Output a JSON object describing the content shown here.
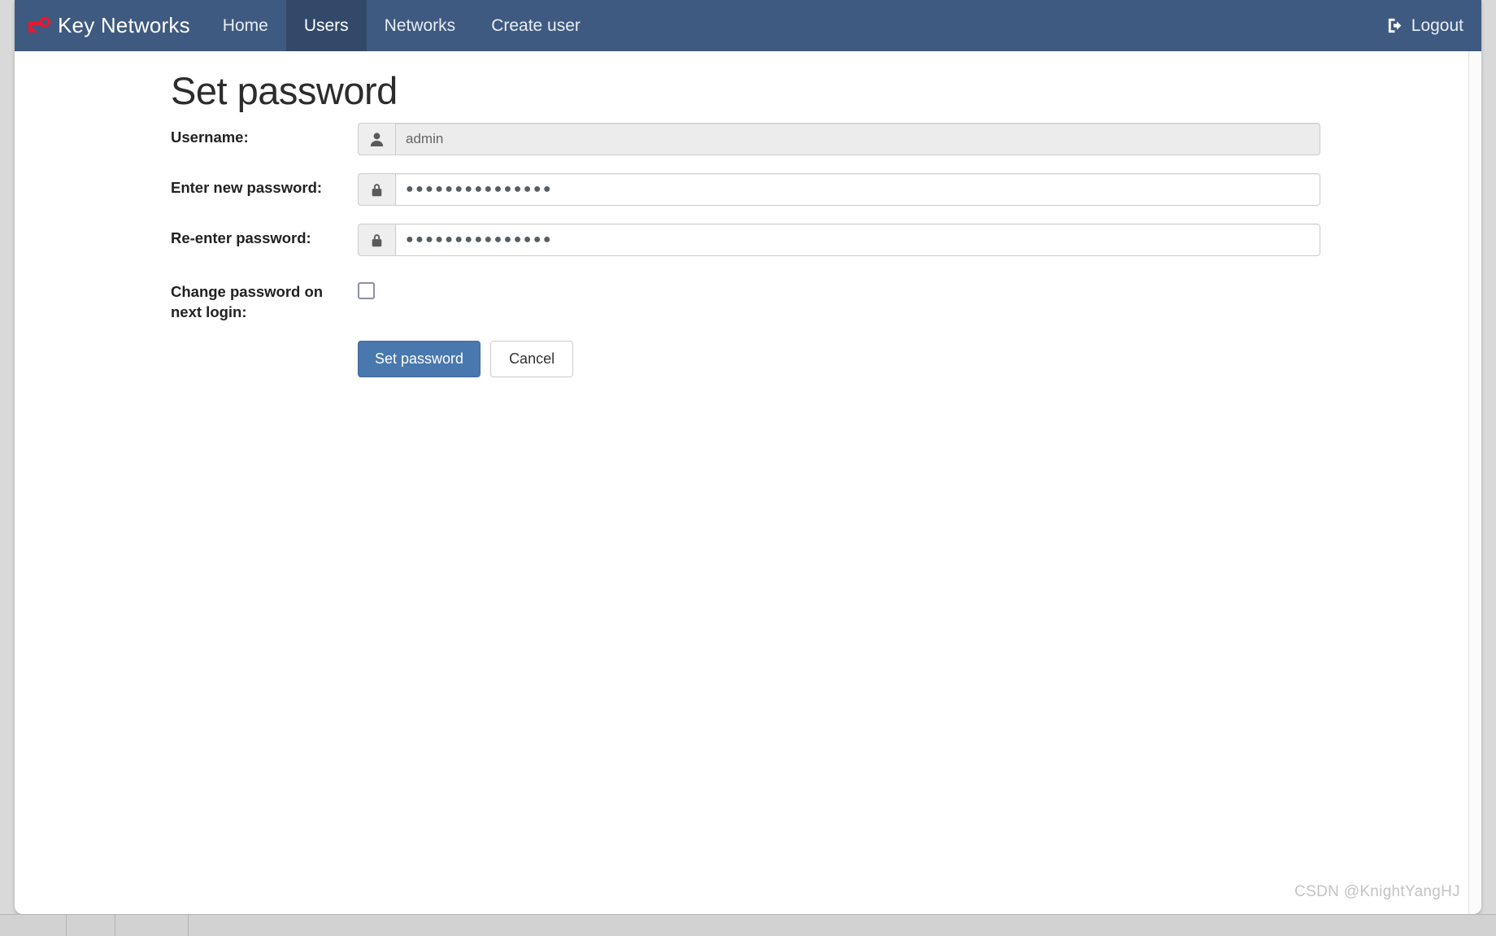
{
  "navbar": {
    "brand": "Key Networks",
    "brand_logo_icon": "key-icon",
    "brand_logo_color": "#e8192c",
    "background_color": "#3e5a80",
    "active_background_color": "#33496a",
    "links": [
      {
        "label": "Home",
        "active": false
      },
      {
        "label": "Users",
        "active": true
      },
      {
        "label": "Networks",
        "active": false
      },
      {
        "label": "Create user",
        "active": false
      }
    ],
    "logout": {
      "label": "Logout",
      "icon": "sign-out-icon"
    }
  },
  "main": {
    "title": "Set password",
    "fields": {
      "username": {
        "label": "Username:",
        "addon_icon": "user-icon",
        "value": "admin",
        "placeholder": "",
        "disabled": true
      },
      "new_password": {
        "label": "Enter new password:",
        "addon_icon": "lock-icon",
        "value": "●●●●●●●●●●●●●●●",
        "placeholder": "",
        "disabled": false
      },
      "confirm_password": {
        "label": "Re-enter password:",
        "addon_icon": "lock-icon",
        "value": "●●●●●●●●●●●●●●●",
        "placeholder": "",
        "disabled": false
      },
      "change_on_next_login": {
        "label": "Change password on next login:",
        "checked": false
      }
    },
    "buttons": {
      "submit": {
        "label": "Set password",
        "color": "#4878ad"
      },
      "cancel": {
        "label": "Cancel"
      }
    }
  },
  "watermark": "CSDN @KnightYangHJ"
}
